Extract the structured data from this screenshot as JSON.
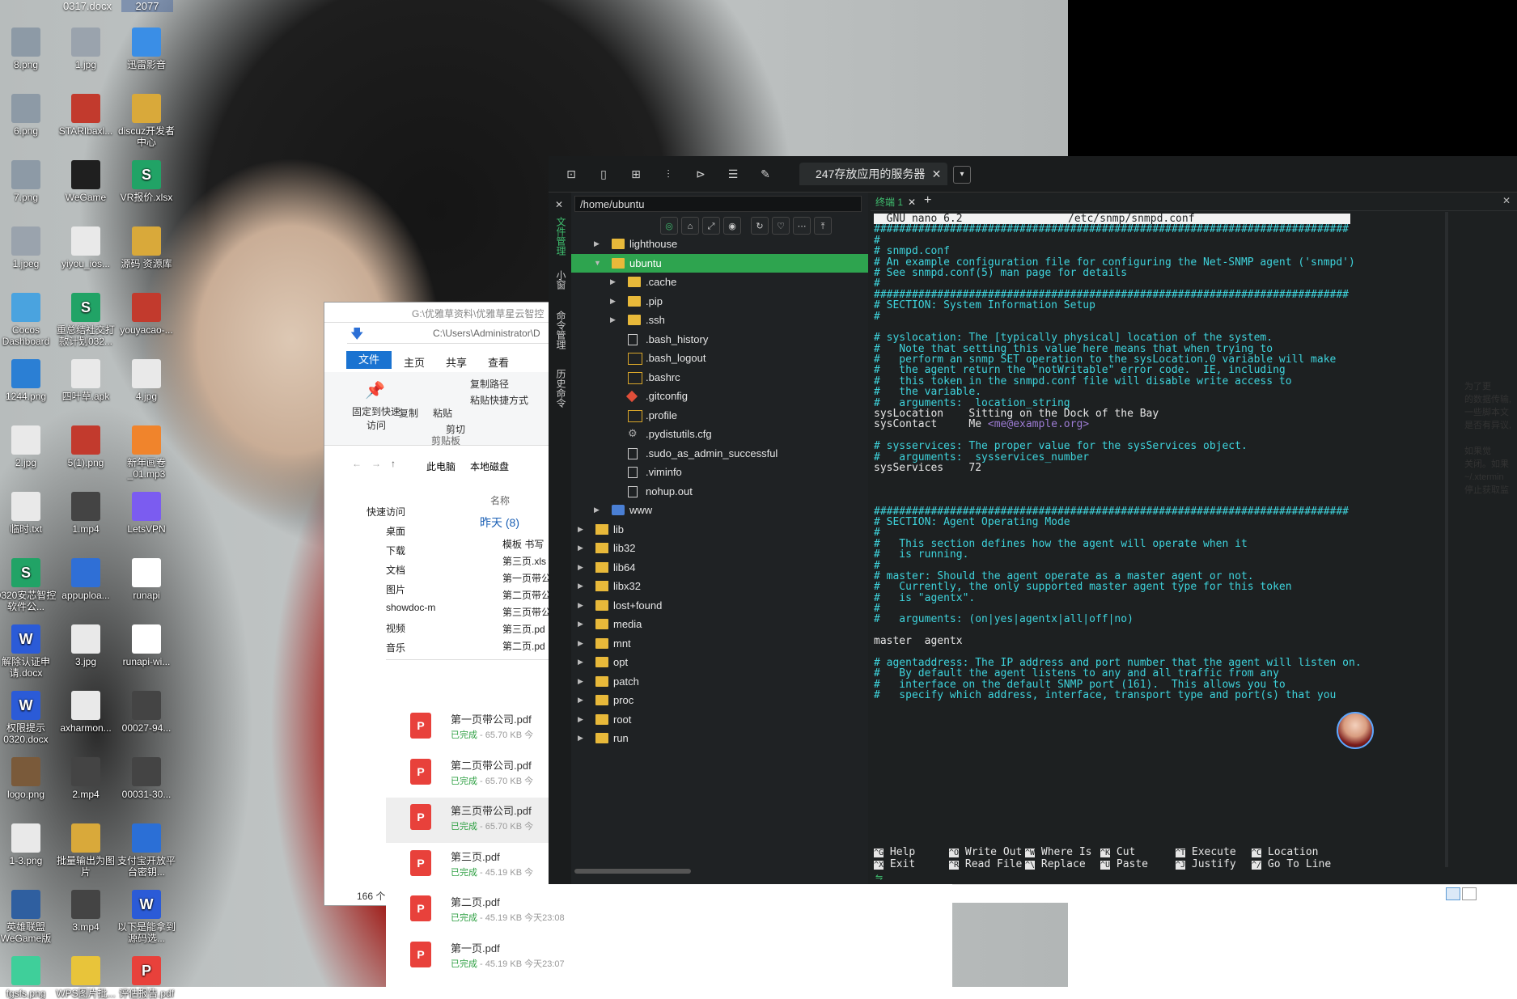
{
  "desktop": {
    "top_files": [
      "0317.docx",
      "2077"
    ],
    "icons": [
      {
        "label": "8.png",
        "icon": "image-icon",
        "color": "#8d9aa6"
      },
      {
        "label": "1.jpg",
        "icon": "image-icon",
        "color": "#9aa3ad"
      },
      {
        "label": "迅雷影音",
        "icon": "player-icon",
        "color": "#3a8ee6"
      },
      {
        "label": "6.png",
        "icon": "image-icon",
        "color": "#8d9aa6"
      },
      {
        "label": "STARIbaxl...",
        "icon": "archive-icon",
        "color": "#c23a2d"
      },
      {
        "label": "discuz开发者中心",
        "icon": "folder-icon",
        "color": "#d9a93a"
      },
      {
        "label": "7.png",
        "icon": "image-icon",
        "color": "#8d9aa6"
      },
      {
        "label": "WeGame",
        "icon": "wegame-icon",
        "color": "#1f1f1f"
      },
      {
        "label": "VR报价.xlsx",
        "icon": "spreadsheet-icon",
        "color": "#21a366"
      },
      {
        "label": "1.jpeg",
        "icon": "image-icon",
        "color": "#9aa3ad"
      },
      {
        "label": "yiyou_ios...",
        "icon": "file-icon",
        "color": "#e9e9e9"
      },
      {
        "label": "源码 资源库",
        "icon": "folder-icon",
        "color": "#d9a93a"
      },
      {
        "label": "Cocos Dashboard",
        "icon": "cocos-icon",
        "color": "#4aa3df"
      },
      {
        "label": "重总结社交打款计划032...",
        "icon": "spreadsheet-icon",
        "color": "#21a366"
      },
      {
        "label": "youyacao-...",
        "icon": "archive-icon",
        "color": "#c23a2d"
      },
      {
        "label": "1244.png",
        "icon": "image-icon",
        "color": "#2b7fd4"
      },
      {
        "label": "四叶草.apk",
        "icon": "file-icon",
        "color": "#e9e9e9"
      },
      {
        "label": "4.jpg",
        "icon": "file-icon",
        "color": "#e9e9e9"
      },
      {
        "label": "2.jpg",
        "icon": "file-icon",
        "color": "#e9e9e9"
      },
      {
        "label": "5(1).png",
        "icon": "image-icon",
        "color": "#c23a2d"
      },
      {
        "label": "新年画卷_01.mp3",
        "icon": "audio-icon",
        "color": "#f0842c"
      },
      {
        "label": "临时.txt",
        "icon": "text-file-icon",
        "color": "#e9e9e9"
      },
      {
        "label": "1.mp4",
        "icon": "video-icon",
        "color": "#444444"
      },
      {
        "label": "LetsVPN",
        "icon": "vpn-icon",
        "color": "#7b5cf0"
      },
      {
        "label": "0320安芯智控软件公...",
        "icon": "spreadsheet-icon",
        "color": "#21a366"
      },
      {
        "label": "appuploa...",
        "icon": "app-icon",
        "color": "#2f6fd6"
      },
      {
        "label": "runapi",
        "icon": "runapi-icon",
        "color": "#ffffff"
      },
      {
        "label": "解除认证申请.docx",
        "icon": "word-icon",
        "color": "#2b5bd7"
      },
      {
        "label": "3.jpg",
        "icon": "image-icon",
        "color": "#e9e9e9"
      },
      {
        "label": "runapi-wi...",
        "icon": "runapi-icon",
        "color": "#ffffff"
      },
      {
        "label": "权限提示0320.docx",
        "icon": "word-icon",
        "color": "#2b5bd7"
      },
      {
        "label": "axharmon...",
        "icon": "file-icon",
        "color": "#e9e9e9"
      },
      {
        "label": "00027-94...",
        "icon": "video-icon",
        "color": "#444444"
      },
      {
        "label": "logo.png",
        "icon": "image-icon",
        "color": "#7a5a3a"
      },
      {
        "label": "2.mp4",
        "icon": "video-icon",
        "color": "#444444"
      },
      {
        "label": "00031-30...",
        "icon": "video-icon",
        "color": "#444444"
      },
      {
        "label": "1-3.png",
        "icon": "image-icon",
        "color": "#e9e9e9"
      },
      {
        "label": "批量输出为图片",
        "icon": "folder-icon",
        "color": "#d9a93a"
      },
      {
        "label": "支付宝开放平台密钥...",
        "icon": "shield-icon",
        "color": "#2b6fd6"
      },
      {
        "label": "英雄联盟WeGame版",
        "icon": "lol-icon",
        "color": "#2f5fa0"
      },
      {
        "label": "3.mp4",
        "icon": "video-icon",
        "color": "#444444"
      },
      {
        "label": "以下是能拿到源码选...",
        "icon": "word-icon",
        "color": "#2b5bd7"
      },
      {
        "label": "fgsfs.png",
        "icon": "image-icon",
        "color": "#3fcf9a"
      },
      {
        "label": "WPS图片批...",
        "icon": "folder-icon",
        "color": "#e8c43a"
      },
      {
        "label": "评估报告.pdf",
        "icon": "pdf-icon",
        "color": "#e8413b"
      }
    ],
    "right_peek_lines": [
      "为了更",
      "的数据传输,",
      "一些脚本文",
      "是否有异议,",
      "",
      "如果觉",
      "关闭。如果",
      "~/.xtermin",
      "停止获取监"
    ]
  },
  "explorer": {
    "path1": "G:\\优雅草资料\\优雅草星云智控",
    "path2": "C:\\Users\\Administrator\\D",
    "ribbon_tabs": [
      "文件",
      "主页",
      "共享",
      "查看"
    ],
    "ribbon": {
      "pin": "固定到快速访问",
      "copy": "复制",
      "paste": "粘贴",
      "copy_path": "复制路径",
      "paste_shortcut": "粘贴快捷方式",
      "cut": "剪切",
      "clipboard": "剪贴板"
    },
    "breadcrumb": [
      "此电脑",
      "本地磁盘"
    ],
    "nav": [
      "快速访问",
      "桌面",
      "下载",
      "文档",
      "图片",
      "showdoc-m",
      "视频",
      "音乐"
    ],
    "col_name": "名称",
    "group": "昨天 (8)",
    "files": [
      "模板 书写",
      "第三页.xls",
      "第一页带公",
      "第二页带公",
      "第三页带公",
      "第三页.pd",
      "第二页.pd"
    ],
    "count": "166 个"
  },
  "downloads": [
    {
      "name": "第一页带公司.pdf",
      "status": "已完成",
      "size": "65.70 KB",
      "time": "今"
    },
    {
      "name": "第二页带公司.pdf",
      "status": "已完成",
      "size": "65.70 KB",
      "time": "今"
    },
    {
      "name": "第三页带公司.pdf",
      "status": "已完成",
      "size": "65.70 KB",
      "time": "今"
    },
    {
      "name": "第三页.pdf",
      "status": "已完成",
      "size": "45.19 KB",
      "time": "今"
    },
    {
      "name": "第二页.pdf",
      "status": "已完成",
      "size": "45.19 KB",
      "time": "今天23:08"
    },
    {
      "name": "第一页.pdf",
      "status": "已完成",
      "size": "45.19 KB",
      "time": "今天23:07"
    }
  ],
  "app": {
    "session_tab": "247存放应用的服务器",
    "side_labels": [
      "文件管理",
      "小窗",
      "命令管理",
      "历史命令"
    ],
    "path": "/home/ubuntu",
    "tree": [
      {
        "name": "lighthouse",
        "type": "folder",
        "depth": 2,
        "arrow": "▸",
        "selected": false
      },
      {
        "name": "ubuntu",
        "type": "folder",
        "depth": 2,
        "arrow": "▾",
        "selected": true
      },
      {
        "name": ".cache",
        "type": "folder",
        "depth": 3,
        "arrow": "▸",
        "selected": false
      },
      {
        "name": ".pip",
        "type": "folder",
        "depth": 3,
        "arrow": "▸",
        "selected": false
      },
      {
        "name": ".ssh",
        "type": "folder",
        "depth": 3,
        "arrow": "▸",
        "selected": false
      },
      {
        "name": ".bash_history",
        "type": "file",
        "depth": 3,
        "arrow": "",
        "selected": false
      },
      {
        "name": ".bash_logout",
        "type": "term",
        "depth": 3,
        "arrow": "",
        "selected": false
      },
      {
        "name": ".bashrc",
        "type": "term",
        "depth": 3,
        "arrow": "",
        "selected": false
      },
      {
        "name": ".gitconfig",
        "type": "git",
        "depth": 3,
        "arrow": "",
        "selected": false
      },
      {
        "name": ".profile",
        "type": "term",
        "depth": 3,
        "arrow": "",
        "selected": false
      },
      {
        "name": ".pydistutils.cfg",
        "type": "gear",
        "depth": 3,
        "arrow": "",
        "selected": false
      },
      {
        "name": ".sudo_as_admin_successful",
        "type": "file",
        "depth": 3,
        "arrow": "",
        "selected": false
      },
      {
        "name": ".viminfo",
        "type": "file",
        "depth": 3,
        "arrow": "",
        "selected": false
      },
      {
        "name": "nohup.out",
        "type": "file",
        "depth": 3,
        "arrow": "",
        "selected": false
      },
      {
        "name": "www",
        "type": "www",
        "depth": 2,
        "arrow": "▸",
        "selected": false
      },
      {
        "name": "lib",
        "type": "lib",
        "depth": 1,
        "arrow": "▸",
        "selected": false
      },
      {
        "name": "lib32",
        "type": "lib",
        "depth": 1,
        "arrow": "▸",
        "selected": false
      },
      {
        "name": "lib64",
        "type": "lib",
        "depth": 1,
        "arrow": "▸",
        "selected": false
      },
      {
        "name": "libx32",
        "type": "lib",
        "depth": 1,
        "arrow": "▸",
        "selected": false
      },
      {
        "name": "lost+found",
        "type": "folder",
        "depth": 1,
        "arrow": "▸",
        "selected": false
      },
      {
        "name": "media",
        "type": "folder",
        "depth": 1,
        "arrow": "▸",
        "selected": false
      },
      {
        "name": "mnt",
        "type": "folder",
        "depth": 1,
        "arrow": "▸",
        "selected": false
      },
      {
        "name": "opt",
        "type": "folder",
        "depth": 1,
        "arrow": "▸",
        "selected": false
      },
      {
        "name": "patch",
        "type": "folder",
        "depth": 1,
        "arrow": "▸",
        "selected": false
      },
      {
        "name": "proc",
        "type": "folder",
        "depth": 1,
        "arrow": "▸",
        "selected": false
      },
      {
        "name": "root",
        "type": "folder",
        "depth": 1,
        "arrow": "▸",
        "selected": false
      },
      {
        "name": "run",
        "type": "folder",
        "depth": 1,
        "arrow": "▸",
        "selected": false
      }
    ],
    "terminal_tab": "终端 1",
    "nano_header_left": "  GNU nano 6.2",
    "nano_header_file": "/etc/snmp/snmpd.conf",
    "lines": [
      "###########################################################################",
      "#",
      "# snmpd.conf",
      "# An example configuration file for configuring the Net-SNMP agent ('snmpd')",
      "# See snmpd.conf(5) man page for details",
      "#",
      "###########################################################################",
      "# SECTION: System Information Setup",
      "#",
      "",
      "# syslocation: The [typically physical] location of the system.",
      "#   Note that setting this value here means that when trying to",
      "#   perform an snmp SET operation to the sysLocation.0 variable will make",
      "#   the agent return the \"notWritable\" error code.  IE, including",
      "#   this token in the snmpd.conf file will disable write access to",
      "#   the variable.",
      "#   arguments:  location_string",
      "sysLocation    Sitting on the Dock of the Bay",
      "sysContact     Me <me@example.org>",
      "",
      "# sysservices: The proper value for the sysServices object.",
      "#   arguments:  sysservices_number",
      "sysServices    72",
      "",
      "",
      "",
      "###########################################################################",
      "# SECTION: Agent Operating Mode",
      "#",
      "#   This section defines how the agent will operate when it",
      "#   is running.",
      "#",
      "# master: Should the agent operate as a master agent or not.",
      "#   Currently, the only supported master agent type for this token",
      "#   is \"agentx\".",
      "#",
      "#   arguments: (on|yes|agentx|all|off|no)",
      "",
      "master  agentx",
      "",
      "# agentaddress: The IP address and port number that the agent will listen on.",
      "#   By default the agent listens to any and all traffic from any",
      "#   interface on the default SNMP port (161).  This allows you to",
      "#   specify which address, interface, transport type and port(s) that you"
    ],
    "shortcuts": [
      {
        "k1": "^G",
        "l1": "Help",
        "k2": "^X",
        "l2": "Exit"
      },
      {
        "k1": "^O",
        "l1": "Write Out",
        "k2": "^R",
        "l2": "Read File"
      },
      {
        "k1": "^W",
        "l1": "Where Is",
        "k2": "^\\",
        "l2": "Replace"
      },
      {
        "k1": "^K",
        "l1": "Cut",
        "k2": "^U",
        "l2": "Paste"
      },
      {
        "k1": "^T",
        "l1": "Execute",
        "k2": "^J",
        "l2": "Justify"
      },
      {
        "k1": "^C",
        "l1": "Location",
        "k2": "^/",
        "l2": "Go To Line"
      }
    ]
  }
}
